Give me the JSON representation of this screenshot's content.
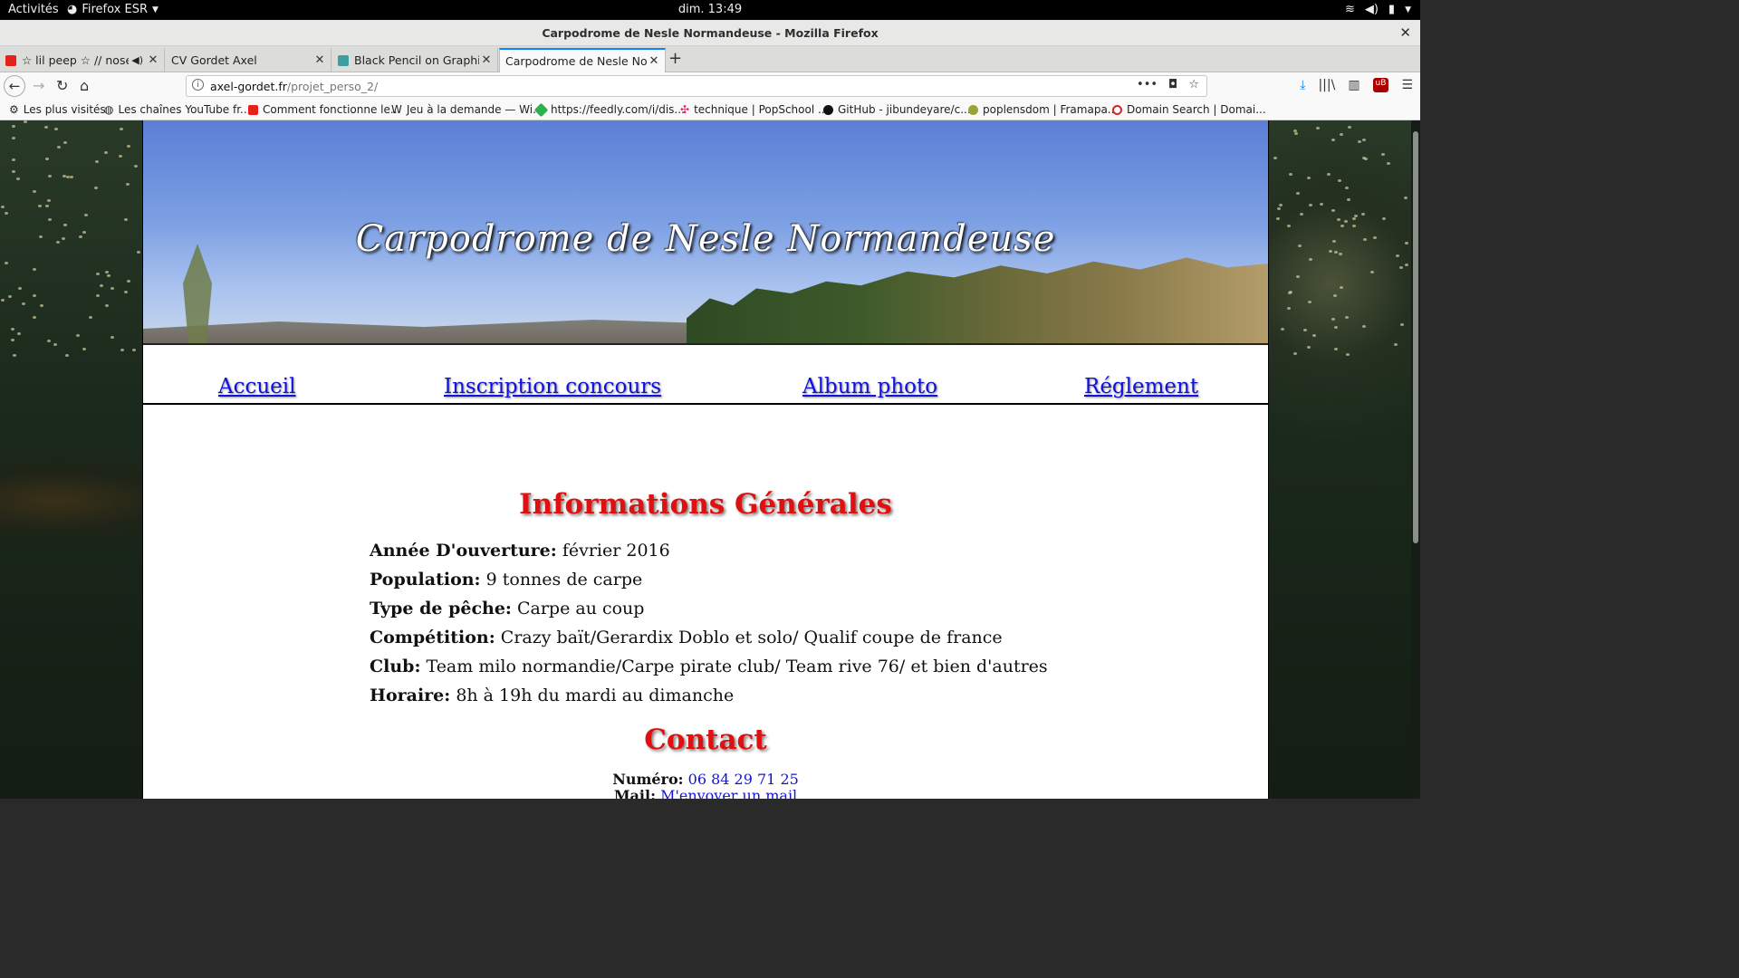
{
  "topbar": {
    "activities": "Activités",
    "app_menu": "Firefox ESR",
    "clock": "dim. 13:49"
  },
  "window": {
    "title": "Carpodrome de Nesle Normandeuse - Mozilla Firefox"
  },
  "tabs": [
    {
      "label": "☆ lil peep ☆ // nose ri",
      "favicon_color": "#e62117",
      "audio": true
    },
    {
      "label": "CV Gordet Axel",
      "favicon_color": "",
      "audio": false
    },
    {
      "label": "Black Pencil on Graphing P",
      "favicon_color": "#3aa0a0",
      "audio": false
    },
    {
      "label": "Carpodrome de Nesle Norma",
      "favicon_color": "",
      "audio": false,
      "active": true
    }
  ],
  "url": {
    "host": "axel-gordet.fr",
    "path": "/projet_perso_2/"
  },
  "bookmarks": [
    {
      "label": "Les plus visités",
      "icon": "gear-icon"
    },
    {
      "label": "Les chaînes YouTube fr...",
      "icon": "globe-icon"
    },
    {
      "label": "Comment fonctionne le...",
      "icon": "youtube-icon"
    },
    {
      "label": "Jeu à la demande — Wi...",
      "icon": "wikipedia-icon"
    },
    {
      "label": "https://feedly.com/i/dis...",
      "icon": "feedly-icon"
    },
    {
      "label": "technique | PopSchool ...",
      "icon": "slack-icon"
    },
    {
      "label": "GitHub - jibundeyare/c...",
      "icon": "github-icon"
    },
    {
      "label": "poplensdom | Framapa...",
      "icon": "framapad-icon"
    },
    {
      "label": "Domain Search | Domai...",
      "icon": "domain-icon"
    }
  ],
  "site": {
    "banner_title": "Carpodrome de Nesle Normandeuse",
    "menu": [
      "Accueil",
      "Inscription concours",
      "Album photo",
      "Réglement"
    ],
    "info_heading": "Informations Générales",
    "info": [
      {
        "label": "Année D'ouverture:",
        "value": " février 2016"
      },
      {
        "label": "Population:",
        "value": " 9 tonnes de carpe"
      },
      {
        "label": "Type de pêche:",
        "value": " Carpe au coup"
      },
      {
        "label": "Compétition:",
        "value": " Crazy baït/Gerardix Doblo et solo/ Qualif coupe de france"
      },
      {
        "label": "Club:",
        "value": " Team milo normandie/Carpe pirate club/ Team rive 76/ et bien d'autres"
      },
      {
        "label": "Horaire:",
        "value": " 8h à 19h du mardi au dimanche"
      }
    ],
    "contact_heading": "Contact",
    "contact": {
      "phone_label": "Numéro:",
      "phone": "06 84 29 71 25",
      "mail_label": "Mail:",
      "mail": "M'envoyer un mail"
    }
  },
  "colors": {
    "heading": "#e01010",
    "link": "#1111dd",
    "tab_accent": "#0a84ff"
  }
}
